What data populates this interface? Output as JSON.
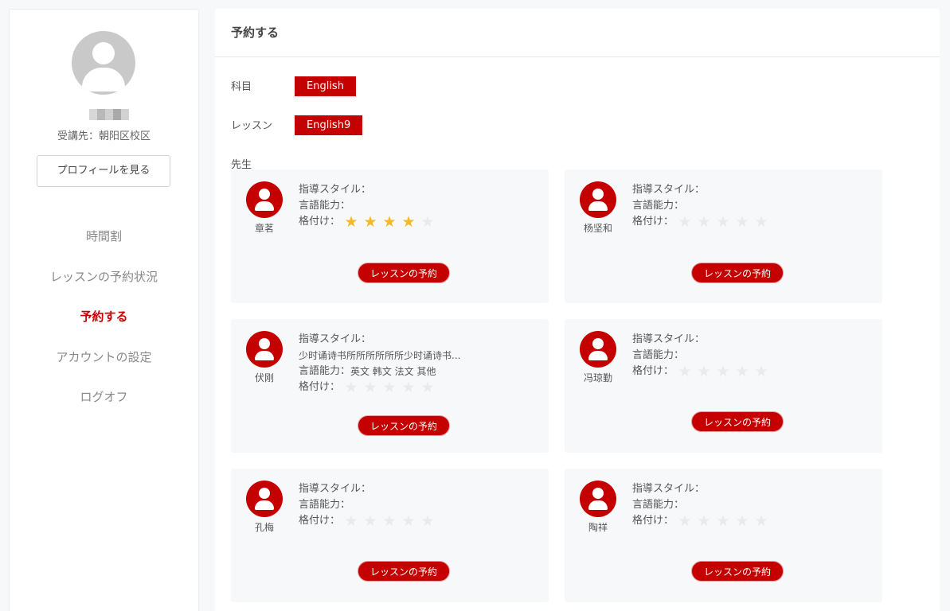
{
  "sidebar": {
    "campus": "受講先：朝阳区校区",
    "profile_button": "プロフィールを見る",
    "nav": [
      "時間割",
      "レッスンの予約状況",
      "予約する",
      "アカウントの設定",
      "ログオフ"
    ],
    "active_index": 2
  },
  "main": {
    "title": "予約する",
    "subject_label": "科目",
    "subject_value": "English",
    "lesson_label": "レッスン",
    "lesson_value": "English9",
    "teacher_label": "先生"
  },
  "teachers": [
    {
      "name": "章茗",
      "style_label": "指導スタイル：",
      "style_desc": "",
      "language_label": "言語能力：",
      "languages": "",
      "rating_label": "格付け：",
      "rating": 4
    },
    {
      "name": "杨坚和",
      "style_label": "指導スタイル：",
      "style_desc": "",
      "language_label": "言語能力：",
      "languages": "",
      "rating_label": "格付け：",
      "rating": 0
    },
    {
      "name": "伏刚",
      "style_label": "指導スタイル：",
      "style_desc": "少时诵诗书所所所所所所少时诵诗书...",
      "language_label": "言語能力：",
      "languages": "英文 韩文 法文 其他",
      "rating_label": "格付け：",
      "rating": 0
    },
    {
      "name": "冯琼勤",
      "style_label": "指導スタイル：",
      "style_desc": "",
      "language_label": "言語能力：",
      "languages": "",
      "rating_label": "格付け：",
      "rating": 0
    },
    {
      "name": "孔梅",
      "style_label": "指導スタイル：",
      "style_desc": "",
      "language_label": "言語能力：",
      "languages": "",
      "rating_label": "格付け：",
      "rating": 0
    },
    {
      "name": "陶祥",
      "style_label": "指導スタイル：",
      "style_desc": "",
      "language_label": "言語能力：",
      "languages": "",
      "rating_label": "格付け：",
      "rating": 0
    }
  ],
  "book_button_label": "レッスンの予約",
  "colors": {
    "accent": "#c40000",
    "star_on": "#f5b82e",
    "star_off": "#eaeaec"
  }
}
